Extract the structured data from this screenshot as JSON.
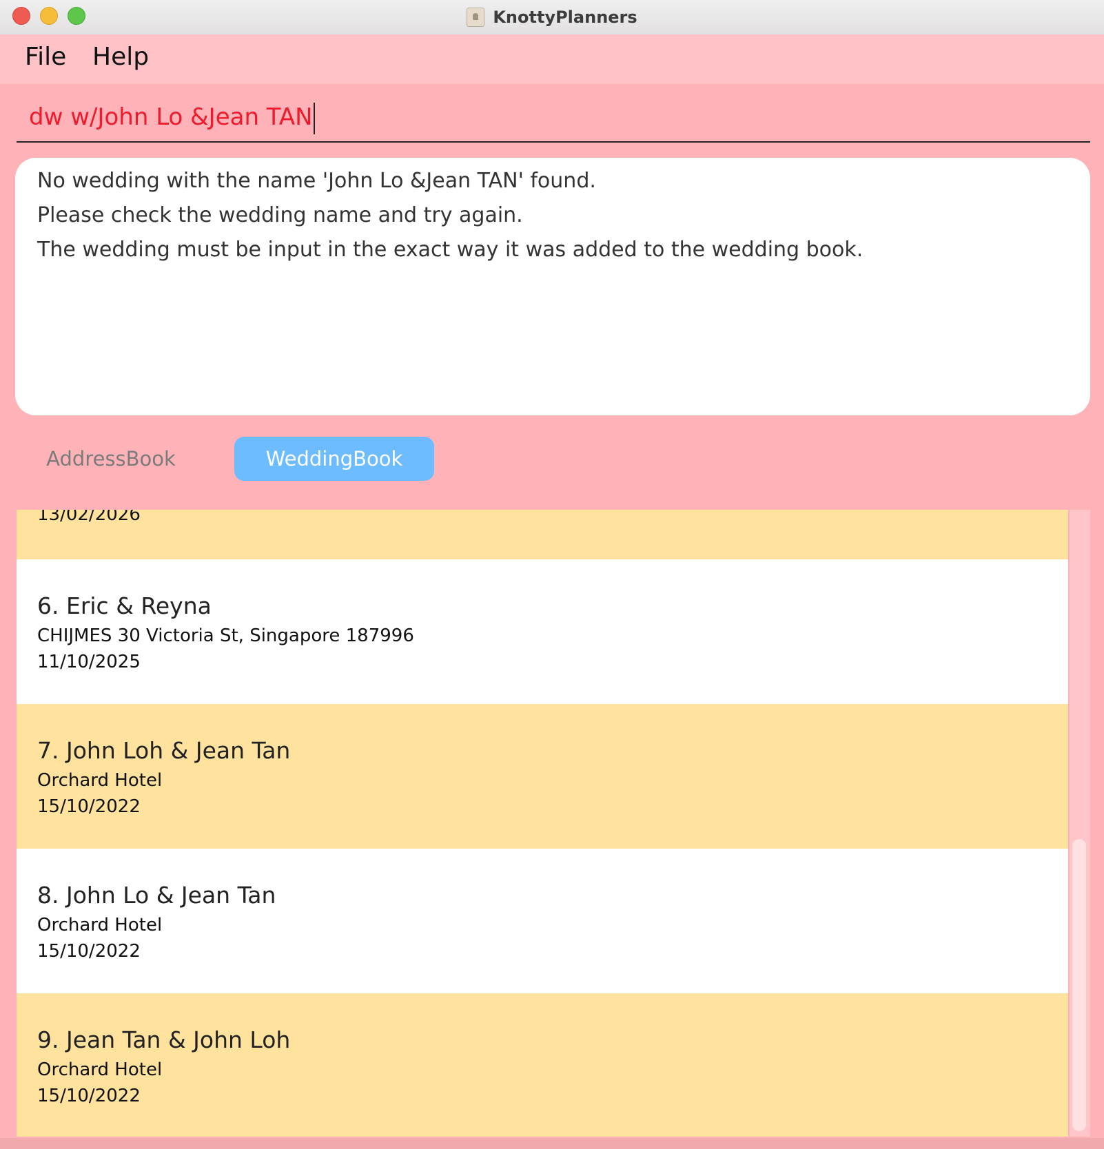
{
  "window": {
    "title": "KnottyPlanners"
  },
  "menubar": {
    "items": [
      {
        "label": "File"
      },
      {
        "label": "Help"
      }
    ]
  },
  "command": {
    "value": "dw w/John Lo &Jean TAN"
  },
  "result": {
    "lines": [
      "No wedding with the name 'John Lo &Jean TAN' found.",
      "Please check the wedding name and try again.",
      "The wedding must be input in the exact way it was added to the wedding book."
    ]
  },
  "tabs": [
    {
      "label": "AddressBook",
      "selected": false
    },
    {
      "label": "WeddingBook",
      "selected": true
    }
  ],
  "weddings": [
    {
      "partial_date": "13/02/2026"
    },
    {
      "title": "6. Eric & Reyna",
      "venue": "CHIJMES 30 Victoria St, Singapore 187996",
      "date": "11/10/2025"
    },
    {
      "title": "7. John Loh & Jean Tan",
      "venue": "Orchard Hotel",
      "date": "15/10/2022"
    },
    {
      "title": "8. John Lo & Jean Tan",
      "venue": "Orchard Hotel",
      "date": "15/10/2022"
    },
    {
      "title": "9. Jean Tan & John Loh",
      "venue": "Orchard Hotel",
      "date": "15/10/2022"
    }
  ],
  "colors": {
    "background": "#ffb3b8",
    "menubar": "#ffc3c7",
    "command_text": "#ef1a2c",
    "card_yellow": "#fee29e",
    "card_white": "#ffffff",
    "tab_selected": "#6cbcff"
  }
}
